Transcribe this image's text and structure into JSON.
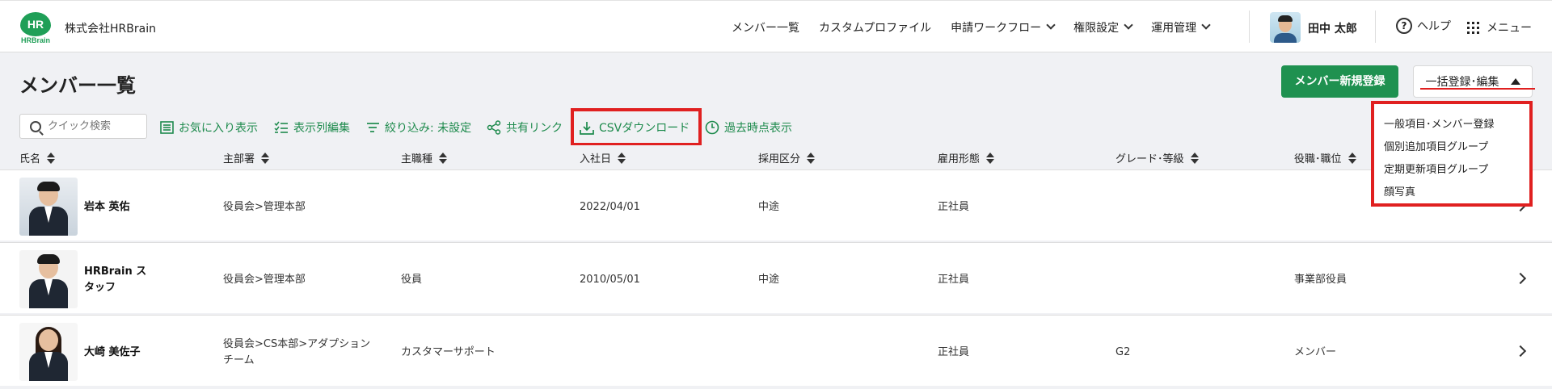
{
  "header": {
    "logo_text": "HR",
    "logo_sub": "HRBrain",
    "company": "株式会社HRBrain",
    "nav": [
      {
        "label": "メンバー一覧",
        "dropdown": false
      },
      {
        "label": "カスタムプロファイル",
        "dropdown": false
      },
      {
        "label": "申請ワークフロー",
        "dropdown": true
      },
      {
        "label": "権限設定",
        "dropdown": true
      },
      {
        "label": "運用管理",
        "dropdown": true
      }
    ],
    "user_name": "田中 太郎",
    "help_label": "ヘルプ",
    "help_glyph": "?",
    "menu_label": "メニュー"
  },
  "page": {
    "title": "メンバー一覧",
    "new_member_button": "メンバー新規登録",
    "bulk_button": "一括登録･編集"
  },
  "toolbar": {
    "search_placeholder": "クイック検索",
    "favorites": "お気に入り表示",
    "edit_columns": "表示列編集",
    "filter": "絞り込み: 未設定",
    "share_link": "共有リンク",
    "csv_download": "CSVダウンロード",
    "past_view": "過去時点表示"
  },
  "table": {
    "columns": [
      "氏名",
      "主部署",
      "主職種",
      "入社日",
      "採用区分",
      "雇用形態",
      "グレード･等級",
      "役職･職位"
    ],
    "rows": [
      {
        "name_lines": [
          "岩本 英佑",
          ""
        ],
        "dept_lines": [
          "役員会>管理本部",
          ""
        ],
        "job": "",
        "joined": "2022/04/01",
        "hire_type": "中途",
        "employment": "正社員",
        "grade": "",
        "position": ""
      },
      {
        "name_lines": [
          "HRBrain ス",
          "タッフ"
        ],
        "dept_lines": [
          "役員会>管理本部",
          ""
        ],
        "job": "役員",
        "joined": "2010/05/01",
        "hire_type": "中途",
        "employment": "正社員",
        "grade": "",
        "position": "事業部役員"
      },
      {
        "name_lines": [
          "大崎 美佐子",
          ""
        ],
        "dept_lines": [
          "役員会>CS本部>アダプション",
          "チーム"
        ],
        "job": "カスタマーサポート",
        "joined": "",
        "hire_type": "",
        "employment": "正社員",
        "grade": "G2",
        "position": "メンバー"
      }
    ]
  },
  "dropdown": {
    "items": [
      "一般項目･メンバー登録",
      "個別追加項目グループ",
      "定期更新項目グループ",
      "顔写真"
    ]
  },
  "colors": {
    "brand_green": "#1f9150",
    "link_green": "#1d8a4c",
    "highlight_red": "#e02020"
  }
}
